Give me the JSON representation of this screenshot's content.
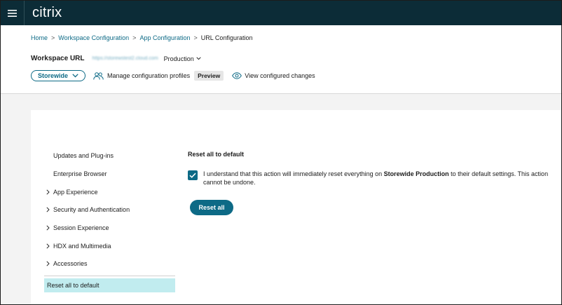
{
  "app": {
    "logo_text": "citrix",
    "brand_color": "#0c2c37",
    "accent_color": "#0d6a86"
  },
  "breadcrumb": {
    "items": [
      "Home",
      "Workspace Configuration",
      "App Configuration"
    ],
    "current": "URL Configuration",
    "separator": ">"
  },
  "workspace": {
    "label": "Workspace URL",
    "url": "https://storewstest2.cloud.com",
    "environment": "Production"
  },
  "controls": {
    "store_label": "Storewide",
    "manage_label": "Manage configuration profiles",
    "preview_badge": "Preview",
    "view_changes_label": "View configured changes"
  },
  "sidebar": {
    "items": [
      {
        "label": "Updates and Plug-ins",
        "expandable": false
      },
      {
        "label": "Enterprise Browser",
        "expandable": false
      },
      {
        "label": "App Experience",
        "expandable": true
      },
      {
        "label": "Security and Authentication",
        "expandable": true
      },
      {
        "label": "Session Experience",
        "expandable": true
      },
      {
        "label": "HDX and Multimedia",
        "expandable": true
      },
      {
        "label": "Accessories",
        "expandable": true
      }
    ],
    "active_label": "Reset all to default"
  },
  "content": {
    "title": "Reset all to default",
    "checkbox_checked": true,
    "ack_prefix": "I understand that this action will immediately reset everything on ",
    "ack_bold": "Storewide Production",
    "ack_suffix": " to their default settings. This action cannot be undone.",
    "reset_button": "Reset all"
  }
}
